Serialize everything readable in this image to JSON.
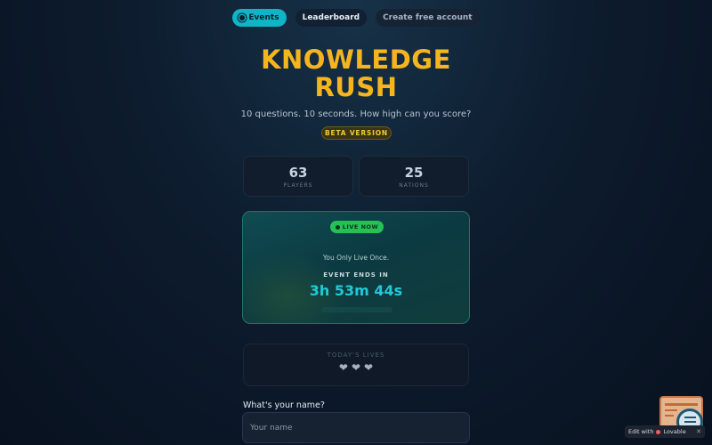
{
  "nav": {
    "events_label": "Events",
    "leaderboard_label": "Leaderboard",
    "create_account_label": "Create free account"
  },
  "hero": {
    "title_line1": "KNOWLEDGE",
    "title_line2": "RUSH",
    "subtitle": "10 questions. 10 seconds. How high can you score?",
    "beta_label": "BETA VERSION"
  },
  "stats": [
    {
      "value": "63",
      "label": "PLAYERS"
    },
    {
      "value": "25",
      "label": "NATIONS"
    }
  ],
  "event": {
    "live_label": "LIVE NOW",
    "tagline": "You Only Live Once.",
    "ends_label": "EVENT ENDS IN",
    "countdown": "3h 53m 44s"
  },
  "lives": {
    "label": "TODAY'S LIVES",
    "hearts": [
      "❤",
      "❤",
      "❤"
    ]
  },
  "form": {
    "name_label": "What's your name?",
    "name_placeholder": "Your name",
    "name_value": ""
  },
  "footer_badge": {
    "text": "Edit with",
    "brand": "Lovable",
    "close": "✕"
  },
  "colors": {
    "accent": "#11b3c7",
    "title": "#f6b51e",
    "live": "#25c155",
    "countdown": "#21c9d8"
  }
}
